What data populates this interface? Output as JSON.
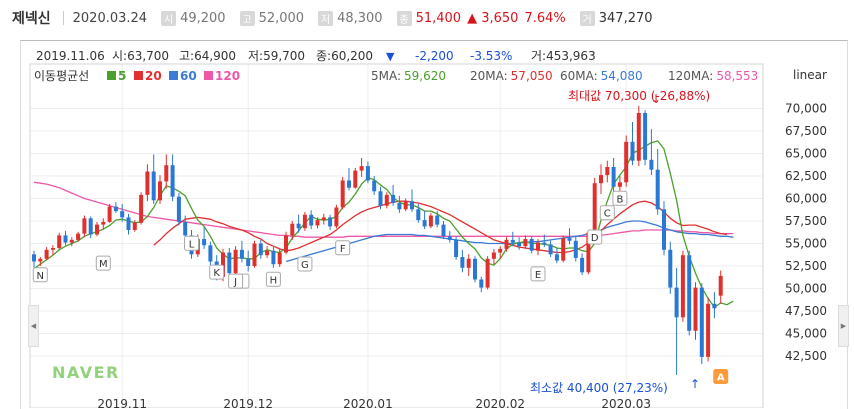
{
  "header": {
    "name": "제넥신",
    "date": "2020.03.24",
    "items": [
      {
        "label": "시",
        "value": "49,200"
      },
      {
        "label": "고",
        "value": "52,000"
      },
      {
        "label": "저",
        "value": "48,300"
      },
      {
        "label": "종",
        "value": "51,400",
        "change": "▲ 3,650",
        "pct": "7.64%"
      },
      {
        "label": "거",
        "value": "347,270"
      }
    ]
  },
  "info_line": {
    "date": "2019.11.06",
    "open": "시:63,700",
    "high": "고:64,900",
    "low": "저:59,700",
    "close": "종:60,200",
    "arrow": "▼",
    "change": "-2,200",
    "pct": "-3.53%",
    "volume": "거:453,963"
  },
  "ma_legend": {
    "title": "이동평균선",
    "items": [
      {
        "label": "5",
        "color": "#4aa02c"
      },
      {
        "label": "20",
        "color": "#e03030"
      },
      {
        "label": "60",
        "color": "#3a7bd5"
      },
      {
        "label": "120",
        "color": "#ee58a8"
      }
    ]
  },
  "ma_values": [
    {
      "label": "5MA:",
      "value": "59,620",
      "color": "#4aa02c"
    },
    {
      "label": "20MA:",
      "value": "57,050",
      "color": "#e03030"
    },
    {
      "label": "60MA:",
      "value": "54,080",
      "color": "#3a7bd5"
    },
    {
      "label": "120MA:",
      "value": "58,553",
      "color": "#ee58a8"
    }
  ],
  "scale_label": "linear",
  "max_label": "최대값 70,300 (-26,88%)",
  "min_label": "최소값 40,400 (27,23%)",
  "logo": "NAVER",
  "chart_data": {
    "type": "candlestick",
    "y_ticks": [
      "70,000",
      "67,500",
      "65,000",
      "62,500",
      "60,000",
      "57,500",
      "55,000",
      "52,500",
      "50,000",
      "47,500",
      "45,000",
      "42,500"
    ],
    "ylim": [
      40000,
      72500
    ],
    "x_ticks": [
      {
        "label": "2019.11",
        "i": 14
      },
      {
        "label": "2019.12",
        "i": 34
      },
      {
        "label": "2020.01",
        "i": 53
      },
      {
        "label": "2020.02",
        "i": 74
      },
      {
        "label": "2020.03",
        "i": 94
      }
    ],
    "candles": [
      [
        53800,
        54200,
        52300,
        53000
      ],
      [
        53000,
        53500,
        52500,
        53300
      ],
      [
        53300,
        54600,
        53200,
        54300
      ],
      [
        54300,
        54800,
        53700,
        54500
      ],
      [
        54500,
        56200,
        54300,
        55900
      ],
      [
        55900,
        56400,
        54800,
        55100
      ],
      [
        55100,
        55700,
        54700,
        55400
      ],
      [
        55400,
        56300,
        55200,
        56100
      ],
      [
        56100,
        58100,
        55700,
        57800
      ],
      [
        57800,
        58000,
        55600,
        56000
      ],
      [
        56000,
        57400,
        55800,
        57100
      ],
      [
        57100,
        57800,
        56600,
        57400
      ],
      [
        57400,
        59400,
        57300,
        59100
      ],
      [
        59100,
        59600,
        58400,
        58600
      ],
      [
        58600,
        59400,
        57400,
        57900
      ],
      [
        57900,
        58300,
        56000,
        56500
      ],
      [
        56500,
        57600,
        56300,
        57300
      ],
      [
        57300,
        60700,
        57100,
        60400
      ],
      [
        60400,
        63800,
        59700,
        63000
      ],
      [
        63000,
        64900,
        59400,
        59800
      ],
      [
        59800,
        62600,
        59400,
        61900
      ],
      [
        61900,
        64900,
        61100,
        63700
      ],
      [
        63700,
        64900,
        59700,
        60200
      ],
      [
        60200,
        60600,
        57000,
        57400
      ],
      [
        57400,
        58100,
        55300,
        55900
      ],
      [
        55900,
        56500,
        53300,
        53800
      ],
      [
        53800,
        56000,
        53500,
        55500
      ],
      [
        55500,
        56800,
        54400,
        54800
      ],
      [
        54800,
        55200,
        52600,
        53000
      ],
      [
        53000,
        53700,
        50900,
        51300
      ],
      [
        51300,
        54400,
        50800,
        54000
      ],
      [
        54000,
        54500,
        51200,
        51700
      ],
      [
        51700,
        54700,
        51300,
        54300
      ],
      [
        54300,
        55300,
        52900,
        53300
      ],
      [
        53300,
        54200,
        51900,
        52500
      ],
      [
        52500,
        55300,
        52300,
        55000
      ],
      [
        55000,
        55400,
        53300,
        53700
      ],
      [
        53700,
        54700,
        53400,
        54200
      ],
      [
        54200,
        54600,
        52300,
        52700
      ],
      [
        52700,
        54400,
        52400,
        54000
      ],
      [
        54000,
        56300,
        53800,
        55900
      ],
      [
        55900,
        57500,
        55400,
        57200
      ],
      [
        57200,
        58200,
        56200,
        56700
      ],
      [
        56700,
        58500,
        56400,
        58200
      ],
      [
        58200,
        58700,
        56600,
        57000
      ],
      [
        57000,
        57900,
        56700,
        57600
      ],
      [
        57600,
        58300,
        57100,
        57900
      ],
      [
        57900,
        58200,
        56500,
        56900
      ],
      [
        56900,
        59300,
        56700,
        59000
      ],
      [
        59000,
        62400,
        58800,
        62000
      ],
      [
        62000,
        63400,
        60900,
        61200
      ],
      [
        61200,
        63400,
        61100,
        63100
      ],
      [
        63100,
        64500,
        62400,
        63600
      ],
      [
        63600,
        64100,
        61700,
        62000
      ],
      [
        62000,
        62500,
        60400,
        60800
      ],
      [
        60800,
        61300,
        58800,
        59200
      ],
      [
        59200,
        60700,
        58900,
        60400
      ],
      [
        60400,
        61500,
        59200,
        59500
      ],
      [
        59500,
        60300,
        58400,
        58800
      ],
      [
        58800,
        60000,
        58600,
        59700
      ],
      [
        59700,
        61000,
        58500,
        58800
      ],
      [
        58800,
        59400,
        57300,
        57600
      ],
      [
        57600,
        58600,
        56600,
        56900
      ],
      [
        56900,
        58400,
        56700,
        58100
      ],
      [
        58100,
        58600,
        56800,
        57100
      ],
      [
        57100,
        57500,
        55500,
        55800
      ],
      [
        55800,
        56400,
        55100,
        55400
      ],
      [
        55400,
        55800,
        53200,
        53500
      ],
      [
        53500,
        54300,
        51800,
        52300
      ],
      [
        52300,
        53800,
        51400,
        53300
      ],
      [
        53300,
        53600,
        50700,
        51000
      ],
      [
        51000,
        51300,
        49600,
        50100
      ],
      [
        50100,
        53600,
        49900,
        53300
      ],
      [
        53300,
        54400,
        52700,
        54000
      ],
      [
        54000,
        54700,
        53300,
        54400
      ],
      [
        54400,
        55700,
        54100,
        55400
      ],
      [
        55400,
        56300,
        54700,
        55100
      ],
      [
        55100,
        55700,
        54300,
        54700
      ],
      [
        54700,
        55900,
        54400,
        55500
      ],
      [
        55500,
        55800,
        53900,
        54200
      ],
      [
        54200,
        55500,
        53700,
        55100
      ],
      [
        55100,
        56000,
        54600,
        54900
      ],
      [
        54900,
        55300,
        53500,
        53800
      ],
      [
        53800,
        54500,
        52800,
        53100
      ],
      [
        53100,
        55900,
        52900,
        55600
      ],
      [
        55600,
        56700,
        54900,
        55300
      ],
      [
        55300,
        55800,
        53000,
        53400
      ],
      [
        53400,
        53900,
        51500,
        51800
      ],
      [
        51800,
        56500,
        51600,
        56200
      ],
      [
        56200,
        62300,
        55900,
        61700
      ],
      [
        61700,
        63800,
        60500,
        62600
      ],
      [
        62600,
        64200,
        61800,
        63500
      ],
      [
        63500,
        64500,
        60400,
        61300
      ],
      [
        61300,
        62500,
        59800,
        61800
      ],
      [
        61800,
        67000,
        61300,
        66300
      ],
      [
        66300,
        68500,
        63700,
        64200
      ],
      [
        64200,
        70300,
        63600,
        69500
      ],
      [
        69500,
        69800,
        63700,
        64300
      ],
      [
        64300,
        67700,
        62600,
        63200
      ],
      [
        63200,
        65500,
        58200,
        58800
      ],
      [
        58800,
        59700,
        53700,
        54300
      ],
      [
        54300,
        55200,
        49400,
        50100
      ],
      [
        50100,
        52300,
        40400,
        46800
      ],
      [
        46800,
        54200,
        46300,
        53700
      ],
      [
        53700,
        54200,
        44800,
        45300
      ],
      [
        45300,
        50700,
        44300,
        50100
      ],
      [
        50100,
        50600,
        41600,
        42400
      ],
      [
        42400,
        49000,
        41900,
        48300
      ],
      [
        48300,
        49600,
        46700,
        47800
      ],
      [
        49200,
        52000,
        48300,
        51400
      ]
    ],
    "series": [
      {
        "name": "5",
        "color": "#4aa02c",
        "values": [
          52200,
          52700,
          53200,
          53700,
          54300,
          54700,
          55000,
          55300,
          55800,
          56100,
          56300,
          56600,
          57000,
          57600,
          57700,
          57500,
          57300,
          57400,
          58000,
          59000,
          60300,
          61400,
          61200,
          60800,
          60300,
          58900,
          57600,
          56900,
          55800,
          54500,
          53800,
          53300,
          53400,
          53400,
          53300,
          53300,
          54000,
          54300,
          54100,
          54000,
          54500,
          55600,
          56400,
          57300,
          58000,
          57700,
          57600,
          57700,
          58000,
          59000,
          59600,
          60500,
          61600,
          62300,
          62100,
          61500,
          61000,
          60100,
          59600,
          59300,
          59300,
          59000,
          58600,
          58600,
          58300,
          57800,
          57500,
          56600,
          55700,
          55000,
          54400,
          53400,
          52800,
          52600,
          53300,
          54400,
          54900,
          55100,
          55200,
          55000,
          55000,
          54900,
          54800,
          54500,
          54400,
          54500,
          54500,
          54200,
          54100,
          55000,
          57600,
          59700,
          61600,
          62600,
          63500,
          65000,
          65400,
          65800,
          66200,
          66400,
          65500,
          62800,
          59800,
          55900,
          53600,
          51700,
          50100,
          48900,
          47900,
          48400,
          48200,
          48600
        ]
      },
      {
        "name": "20",
        "color": "#e03030",
        "values": [
          null,
          null,
          null,
          null,
          null,
          null,
          null,
          null,
          null,
          null,
          null,
          null,
          null,
          null,
          null,
          null,
          null,
          null,
          null,
          54800,
          55400,
          56100,
          56700,
          57200,
          57700,
          57800,
          57900,
          57800,
          57700,
          57400,
          57200,
          56900,
          56700,
          56500,
          56200,
          55800,
          55500,
          55000,
          54700,
          54400,
          54200,
          54300,
          54500,
          54800,
          55100,
          55400,
          55700,
          56000,
          56500,
          57100,
          57600,
          58100,
          58500,
          58800,
          59000,
          59200,
          59400,
          59600,
          59700,
          59700,
          59600,
          59500,
          59300,
          59100,
          58800,
          58500,
          58200,
          57800,
          57400,
          57000,
          56600,
          56200,
          55800,
          55400,
          55200,
          55000,
          54800,
          54600,
          54500,
          54400,
          54300,
          54200,
          54100,
          54000,
          54000,
          54100,
          54300,
          54600,
          55100,
          55700,
          56400,
          57100,
          57700,
          58300,
          58800,
          59300,
          59600,
          59700,
          59500,
          59100,
          58500,
          57800,
          57300,
          57000,
          57050,
          57050,
          56800,
          56600,
          56300,
          56100,
          56000
        ]
      },
      {
        "name": "60",
        "color": "#3a7bd5",
        "values": [
          null,
          null,
          null,
          null,
          null,
          null,
          null,
          null,
          null,
          null,
          null,
          null,
          null,
          null,
          null,
          null,
          null,
          null,
          null,
          null,
          null,
          null,
          null,
          null,
          null,
          null,
          null,
          null,
          null,
          null,
          null,
          null,
          null,
          null,
          null,
          null,
          null,
          null,
          null,
          null,
          53000,
          53200,
          53400,
          53600,
          53800,
          54000,
          54200,
          54400,
          54600,
          54800,
          55000,
          55200,
          55400,
          55600,
          55800,
          55900,
          56000,
          56000,
          56000,
          56000,
          56000,
          55900,
          55900,
          55800,
          55700,
          55600,
          55500,
          55400,
          55300,
          55200,
          55100,
          55100,
          55000,
          55000,
          55000,
          55000,
          55000,
          55100,
          55100,
          55200,
          55200,
          55300,
          55400,
          55500,
          55600,
          55700,
          55800,
          55900,
          56100,
          56300,
          56500,
          56800,
          57000,
          57200,
          57400,
          57500,
          57500,
          57400,
          57200,
          57000,
          56700,
          56500,
          56300,
          56200,
          56100,
          56100,
          56000,
          56000,
          55900,
          55800,
          55800,
          55700
        ]
      },
      {
        "name": "120",
        "color": "#ee58a8",
        "values": [
          61800,
          61700,
          61600,
          61400,
          61200,
          60900,
          60600,
          60300,
          60000,
          59800,
          59600,
          59400,
          59200,
          59000,
          58800,
          58600,
          58400,
          58200,
          58000,
          57900,
          57800,
          57700,
          57600,
          57500,
          57400,
          57300,
          57200,
          57100,
          57000,
          56900,
          56800,
          56700,
          56600,
          56500,
          56400,
          56300,
          56200,
          56100,
          56000,
          55900,
          55900,
          55800,
          55800,
          55700,
          55700,
          55700,
          55700,
          55700,
          55700,
          55700,
          55800,
          55800,
          55800,
          55800,
          55800,
          55800,
          55800,
          55800,
          55800,
          55800,
          55800,
          55800,
          55800,
          55800,
          55800,
          55800,
          55800,
          55800,
          55800,
          55800,
          55800,
          55800,
          55800,
          55800,
          55800,
          55800,
          55800,
          55800,
          55800,
          55800,
          55800,
          55800,
          55800,
          55800,
          55800,
          55800,
          55800,
          55800,
          55800,
          55800,
          55900,
          56000,
          56100,
          56200,
          56300,
          56400,
          56400,
          56500,
          56500,
          56500,
          56500,
          56500,
          56400,
          56400,
          56300,
          56300,
          56200,
          56200,
          56100,
          56100,
          56100,
          56100
        ]
      }
    ],
    "markers": [
      {
        "label": "A",
        "i": 109,
        "price": 41000,
        "highlight": true
      },
      {
        "label": "B",
        "i": 93,
        "price": 60800
      },
      {
        "label": "C",
        "i": 91,
        "price": 59200
      },
      {
        "label": "D",
        "i": 89,
        "price": 56500
      },
      {
        "label": "E",
        "i": 80,
        "price": 52400
      },
      {
        "label": "F",
        "i": 49,
        "price": 55300
      },
      {
        "label": "G",
        "i": 43,
        "price": 53500
      },
      {
        "label": "H",
        "i": 38,
        "price": 51800
      },
      {
        "label": "I",
        "i": 33,
        "price": 51600
      },
      {
        "label": "J",
        "i": 32,
        "price": 51600
      },
      {
        "label": "K",
        "i": 29,
        "price": 52600
      },
      {
        "label": "L",
        "i": 25,
        "price": 55800
      },
      {
        "label": "M",
        "i": 11,
        "price": 53600
      },
      {
        "label": "N",
        "i": 1,
        "price": 52300
      }
    ]
  }
}
